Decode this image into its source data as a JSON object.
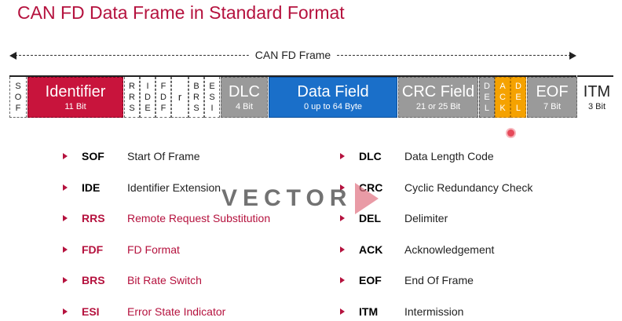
{
  "title": "CAN FD Data Frame in Standard Format",
  "frame_span_label": "CAN FD Frame",
  "colors": {
    "accent": "#b5123e",
    "identifier": "#c8143c",
    "dlc": "#9a9a9a",
    "data": "#1a6fc9",
    "crc": "#9a9a9a",
    "ack": "#f5a200",
    "eof": "#9a9a9a"
  },
  "fields": {
    "sof": [
      "S",
      "O",
      "F"
    ],
    "identifier": {
      "name": "Identifier",
      "sub": "11 Bit"
    },
    "rrs": [
      "R",
      "R",
      "S"
    ],
    "ide": [
      "I",
      "D",
      "E"
    ],
    "fdf": [
      "F",
      "D",
      "F"
    ],
    "r": "r",
    "brs": [
      "B",
      "R",
      "S"
    ],
    "esi": [
      "E",
      "S",
      "I"
    ],
    "dlc": {
      "name": "DLC",
      "sub": "4 Bit"
    },
    "data": {
      "name": "Data Field",
      "sub": "0 up to 64 Byte"
    },
    "crc": {
      "name": "CRC Field",
      "sub": "21 or 25 Bit"
    },
    "del1": [
      "D",
      "E",
      "L"
    ],
    "ack": [
      "A",
      "C",
      "K"
    ],
    "del2": [
      "D",
      "E",
      "L"
    ],
    "eof": {
      "name": "EOF",
      "sub": "7 Bit"
    },
    "itm": {
      "name": "ITM",
      "sub": "3 Bit"
    }
  },
  "legend_left": [
    {
      "abbr": "SOF",
      "desc": "Start Of Frame"
    },
    {
      "abbr": "IDE",
      "desc": "Identifier Extension"
    },
    {
      "abbr": "RRS",
      "desc": "Remote Request Substitution"
    },
    {
      "abbr": "FDF",
      "desc": "FD Format"
    },
    {
      "abbr": "BRS",
      "desc": "Bit Rate Switch"
    },
    {
      "abbr": "ESI",
      "desc": "Error State Indicator"
    }
  ],
  "legend_right": [
    {
      "abbr": "DLC",
      "desc": "Data Length Code"
    },
    {
      "abbr": "CRC",
      "desc": "Cyclic Redundancy Check"
    },
    {
      "abbr": "DEL",
      "desc": "Delimiter"
    },
    {
      "abbr": "ACK",
      "desc": "Acknowledgement"
    },
    {
      "abbr": "EOF",
      "desc": "End Of Frame"
    },
    {
      "abbr": "ITM",
      "desc": "Intermission"
    }
  ],
  "watermark": "VECTOR"
}
